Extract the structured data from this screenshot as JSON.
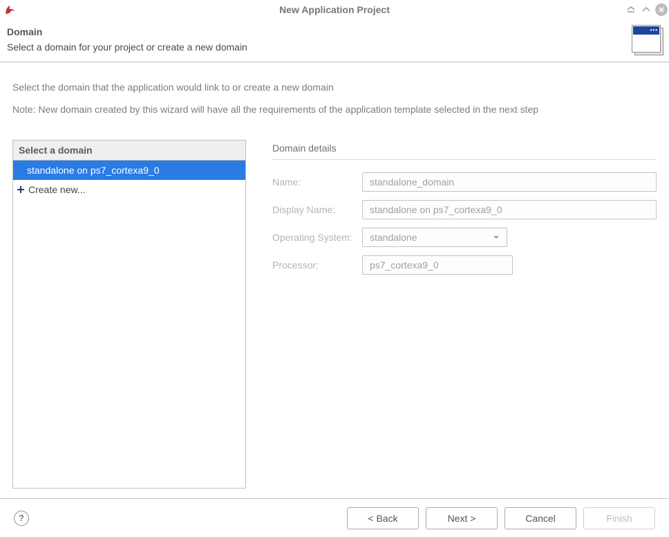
{
  "titlebar": {
    "title": "New Application Project"
  },
  "banner": {
    "title": "Domain",
    "subtitle": "Select a domain for your project or create a new domain"
  },
  "intro": {
    "line1": "Select the domain that the application would link to or create a new domain",
    "line2": "Note: New domain created by this wizard will have all the requirements of the application template selected in the next step"
  },
  "domain_list": {
    "header": "Select a domain",
    "items": [
      {
        "label": "standalone on ps7_cortexa9_0",
        "selected": true
      },
      {
        "label": "Create new...",
        "icon": "plus"
      }
    ]
  },
  "details": {
    "title": "Domain details",
    "fields": {
      "name": {
        "label": "Name:",
        "value": "standalone_domain"
      },
      "display_name": {
        "label": "Display Name:",
        "value": "standalone on ps7_cortexa9_0"
      },
      "os": {
        "label": "Operating System:",
        "value": "standalone"
      },
      "processor": {
        "label": "Processor:",
        "value": "ps7_cortexa9_0"
      }
    }
  },
  "buttons": {
    "back": "< Back",
    "next": "Next >",
    "cancel": "Cancel",
    "finish": "Finish",
    "help_symbol": "?"
  }
}
